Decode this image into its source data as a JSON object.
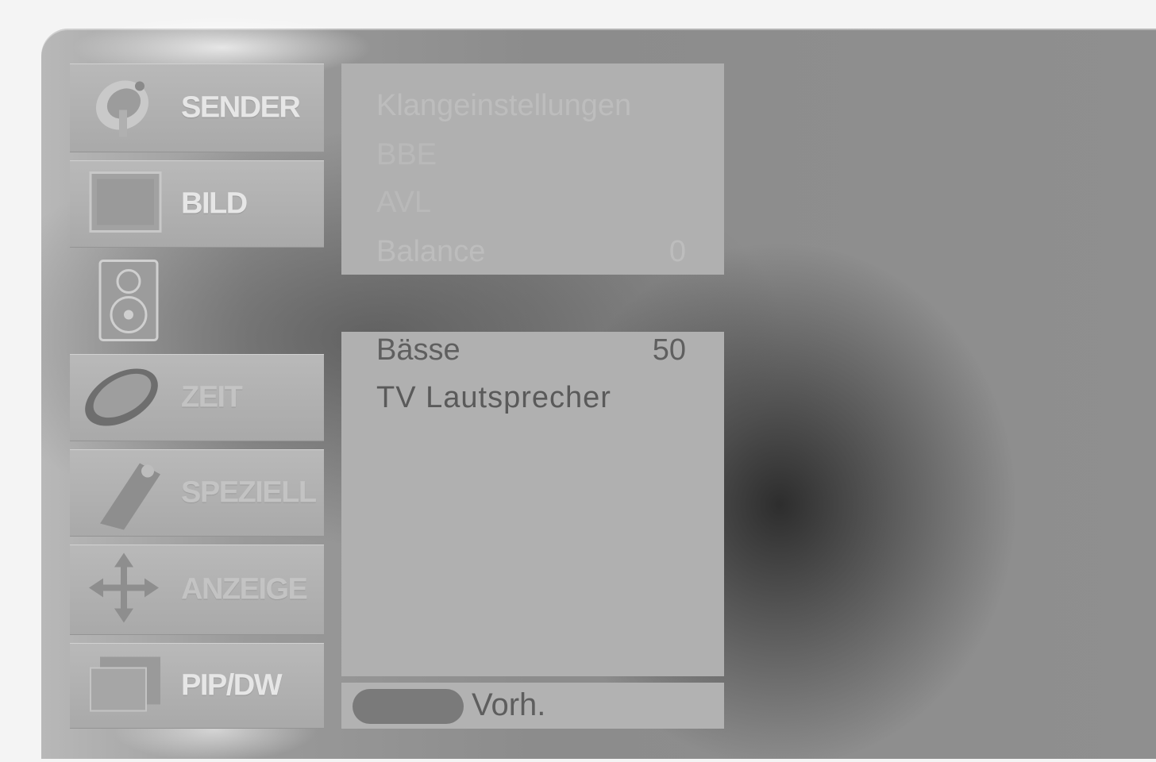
{
  "menu": {
    "tabs": [
      {
        "label": "SENDER",
        "icon": "satellite-dish-icon"
      },
      {
        "label": "BILD",
        "icon": "picture-screen-icon"
      },
      {
        "label": "",
        "icon": "speaker-icon"
      },
      {
        "label": "ZEIT",
        "icon": "clock-icon"
      },
      {
        "label": "SPEZIELL",
        "icon": "tag-icon"
      },
      {
        "label": "ANZEIGE",
        "icon": "move-arrows-icon"
      },
      {
        "label": "PIP/DW",
        "icon": "pip-screen-icon"
      }
    ]
  },
  "audio_panel": {
    "rows": [
      {
        "label": "Klangeinstellungen",
        "value": ""
      },
      {
        "label": "BBE",
        "value": ""
      },
      {
        "label": "AVL",
        "value": ""
      },
      {
        "label": "Balance",
        "value": "0"
      },
      {
        "label": "Bässe",
        "value": "50"
      },
      {
        "label": "TV Lautsprecher",
        "value": ""
      }
    ]
  },
  "footer": {
    "label": "Vorh."
  }
}
